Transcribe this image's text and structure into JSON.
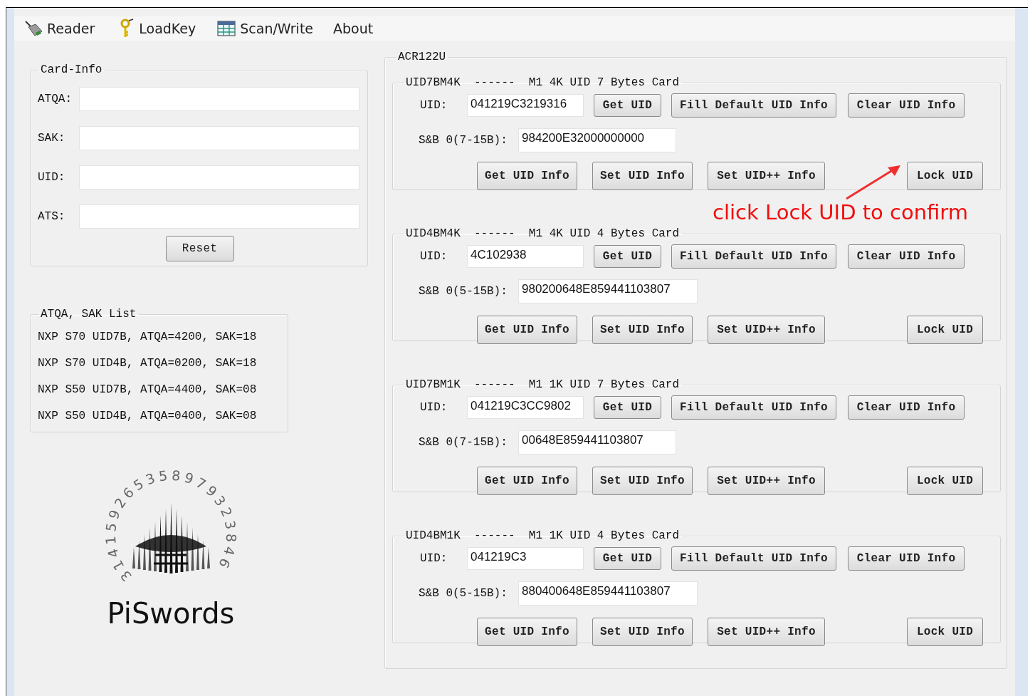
{
  "menu": [
    {
      "label": "Reader",
      "kind": "reader"
    },
    {
      "label": "LoadKey",
      "kind": "key"
    },
    {
      "label": "Scan/Write",
      "kind": "table"
    },
    {
      "label": "About",
      "kind": "none"
    }
  ],
  "card_info": {
    "title": "Card-Info",
    "fields": [
      {
        "label": "ATQA:"
      },
      {
        "label": "SAK:"
      },
      {
        "label": "UID:"
      },
      {
        "label": "ATS:"
      }
    ],
    "reset": "Reset"
  },
  "sak_list": {
    "title": "ATQA, SAK List",
    "lines": [
      "NXP S70 UID7B, ATQA=4200, SAK=18",
      "NXP S70 UID4B, ATQA=0200, SAK=18",
      "NXP S50 UID7B, ATQA=4400, SAK=08",
      "NXP S50 UID4B, ATQA=0400, SAK=08"
    ]
  },
  "logo": {
    "ring": "314159265358979323846",
    "name": "PiSwords"
  },
  "reader_group": {
    "title": "ACR122U",
    "cards": [
      {
        "title": "UID7BM4K  ------  M1 4K UID 7 Bytes Card",
        "uid_label": "UID:",
        "uid": "041219C3219316",
        "get_uid": "Get UID",
        "fill": "Fill Default UID Info",
        "clear": "Clear UID Info",
        "sb_label": "S&B 0(7-15B):",
        "sb_value": "984200E32000000000",
        "buttons": [
          "Get UID Info",
          "Set UID Info",
          "Set UID++ Info"
        ],
        "lock": "Lock UID"
      },
      {
        "title": "UID4BM4K  ------  M1 4K UID 4 Bytes Card",
        "uid_label": "UID:",
        "uid": "4C102938",
        "get_uid": "Get UID",
        "fill": "Fill Default UID Info",
        "clear": "Clear UID Info",
        "sb_label": "S&B 0(5-15B):",
        "sb_value": "980200648E859441103807",
        "buttons": [
          "Get UID Info",
          "Set UID Info",
          "Set UID++ Info"
        ],
        "lock": "Lock UID"
      },
      {
        "title": "UID7BM1K  ------  M1 1K UID 7 Bytes Card",
        "uid_label": "UID:",
        "uid": "041219C3CC9802",
        "get_uid": "Get UID",
        "fill": "Fill Default UID Info",
        "clear": "Clear UID Info",
        "sb_label": "S&B 0(7-15B):",
        "sb_value": "00648E859441103807",
        "buttons": [
          "Get UID Info",
          "Set UID Info",
          "Set UID++ Info"
        ],
        "lock": "Lock UID"
      },
      {
        "title": "UID4BM1K  ------  M1 1K UID 4 Bytes Card",
        "uid_label": "UID:",
        "uid": "041219C3",
        "get_uid": "Get UID",
        "fill": "Fill Default UID Info",
        "clear": "Clear UID Info",
        "sb_label": "S&B 0(5-15B):",
        "sb_value": "880400648E859441103807",
        "buttons": [
          "Get UID Info",
          "Set UID Info",
          "Set UID++ Info"
        ],
        "lock": "Lock UID"
      }
    ]
  },
  "annotation": {
    "text": "click Lock UID to confirm"
  }
}
